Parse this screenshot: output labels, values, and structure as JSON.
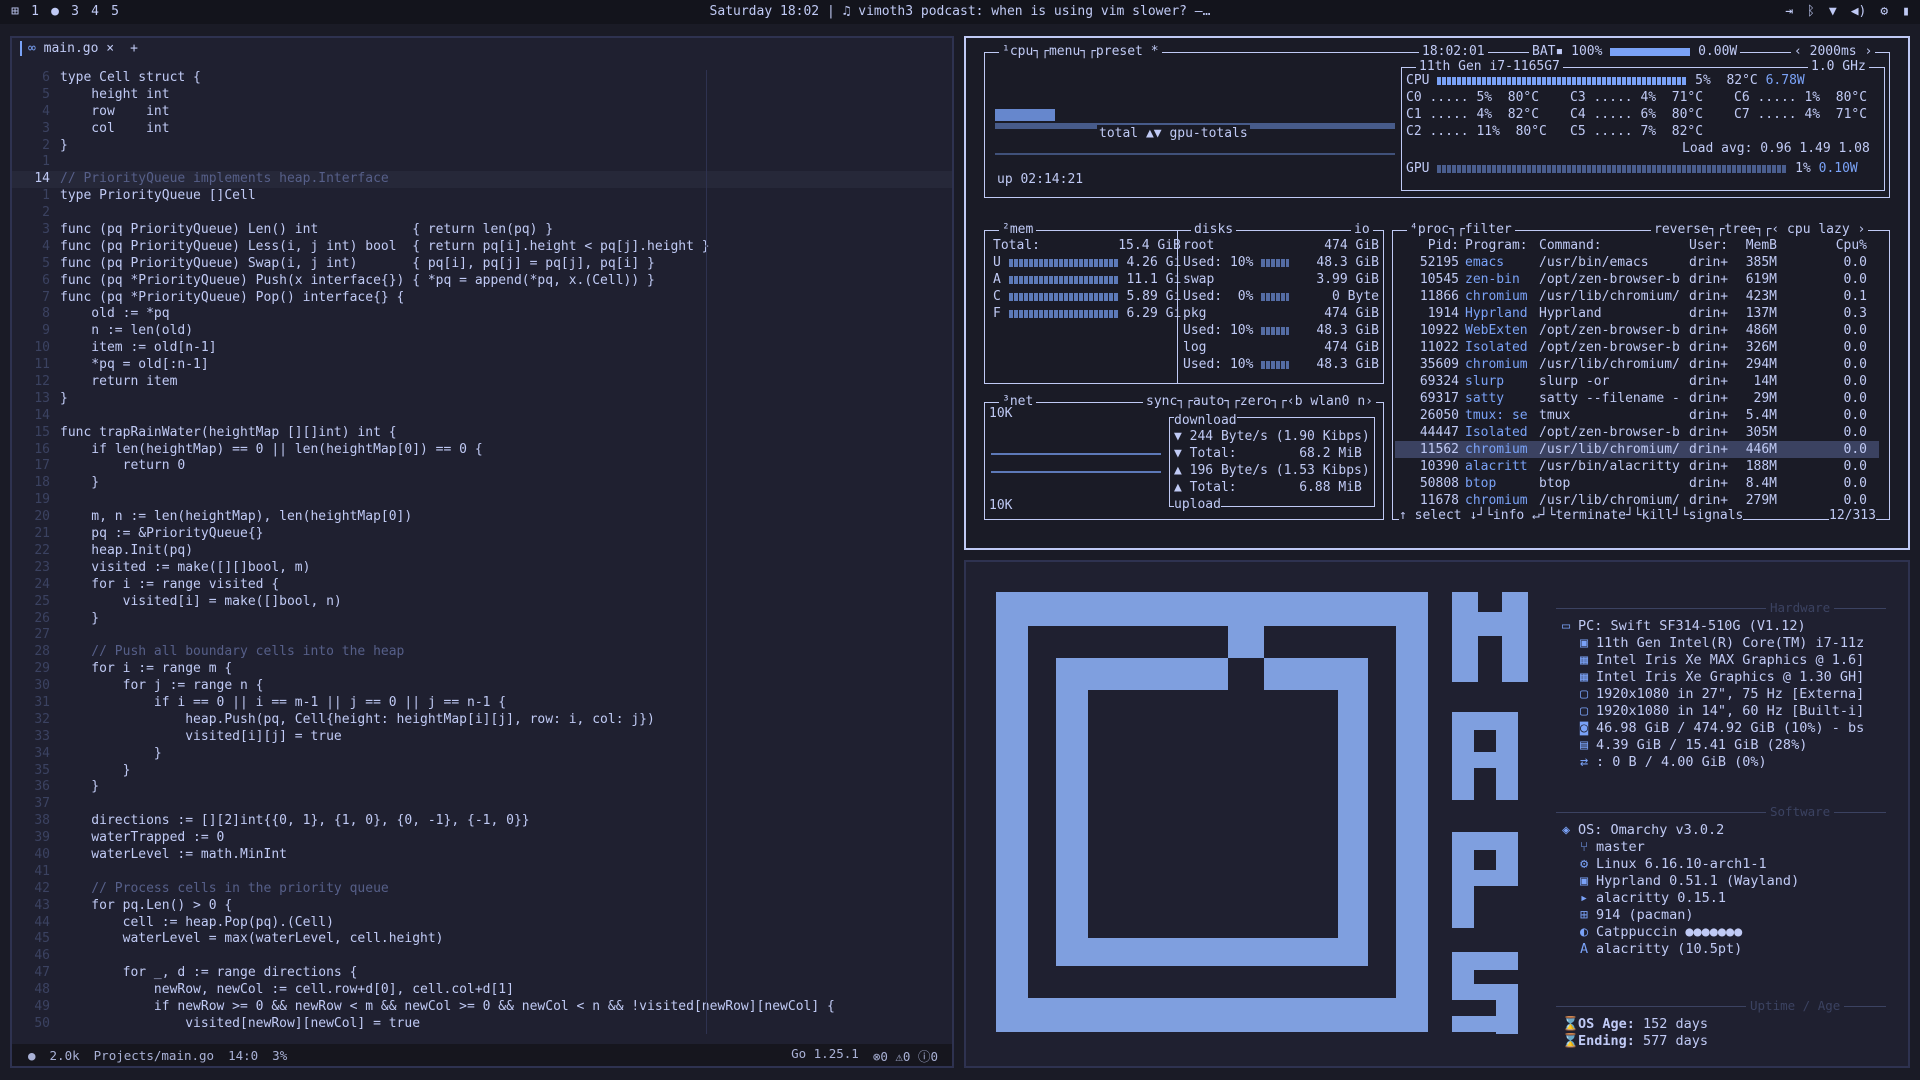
{
  "topbar": {
    "workspaces": [
      "1",
      "2",
      "3",
      "4",
      "5"
    ],
    "center_text": "Saturday 18:02 | ♫ vimoth3 podcast: when is using vim slower? –…"
  },
  "editor": {
    "tab_label": "main.go",
    "code_lines": [
      {
        "n": "6",
        "t": "type Cell struct {"
      },
      {
        "n": "5",
        "t": "    height int"
      },
      {
        "n": "4",
        "t": "    row    int"
      },
      {
        "n": "3",
        "t": "    col    int"
      },
      {
        "n": "2",
        "t": "}"
      },
      {
        "n": "1",
        "t": ""
      },
      {
        "n": "14",
        "t": "// PriorityQueue implements heap.Interface",
        "cur": true,
        "comment": true
      },
      {
        "n": "1",
        "t": "type PriorityQueue []Cell"
      },
      {
        "n": "2",
        "t": ""
      },
      {
        "n": "3",
        "t": "func (pq PriorityQueue) Len() int            { return len(pq) }"
      },
      {
        "n": "4",
        "t": "func (pq PriorityQueue) Less(i, j int) bool  { return pq[i].height < pq[j].height }"
      },
      {
        "n": "5",
        "t": "func (pq PriorityQueue) Swap(i, j int)       { pq[i], pq[j] = pq[j], pq[i] }"
      },
      {
        "n": "6",
        "t": "func (pq *PriorityQueue) Push(x interface{}) { *pq = append(*pq, x.(Cell)) }"
      },
      {
        "n": "7",
        "t": "func (pq *PriorityQueue) Pop() interface{} {"
      },
      {
        "n": "8",
        "t": "    old := *pq"
      },
      {
        "n": "9",
        "t": "    n := len(old)"
      },
      {
        "n": "10",
        "t": "    item := old[n-1]"
      },
      {
        "n": "11",
        "t": "    *pq = old[:n-1]"
      },
      {
        "n": "12",
        "t": "    return item"
      },
      {
        "n": "13",
        "t": "}"
      },
      {
        "n": "14",
        "t": ""
      },
      {
        "n": "15",
        "t": "func trapRainWater(heightMap [][]int) int {"
      },
      {
        "n": "16",
        "t": "    if len(heightMap) == 0 || len(heightMap[0]) == 0 {"
      },
      {
        "n": "17",
        "t": "        return 0"
      },
      {
        "n": "18",
        "t": "    }"
      },
      {
        "n": "19",
        "t": ""
      },
      {
        "n": "20",
        "t": "    m, n := len(heightMap), len(heightMap[0])"
      },
      {
        "n": "21",
        "t": "    pq := &PriorityQueue{}"
      },
      {
        "n": "22",
        "t": "    heap.Init(pq)"
      },
      {
        "n": "23",
        "t": "    visited := make([][]bool, m)"
      },
      {
        "n": "24",
        "t": "    for i := range visited {"
      },
      {
        "n": "25",
        "t": "        visited[i] = make([]bool, n)"
      },
      {
        "n": "26",
        "t": "    }"
      },
      {
        "n": "27",
        "t": ""
      },
      {
        "n": "28",
        "t": "    // Push all boundary cells into the heap",
        "comment": true
      },
      {
        "n": "29",
        "t": "    for i := range m {"
      },
      {
        "n": "30",
        "t": "        for j := range n {"
      },
      {
        "n": "31",
        "t": "            if i == 0 || i == m-1 || j == 0 || j == n-1 {"
      },
      {
        "n": "32",
        "t": "                heap.Push(pq, Cell{height: heightMap[i][j], row: i, col: j})"
      },
      {
        "n": "33",
        "t": "                visited[i][j] = true"
      },
      {
        "n": "34",
        "t": "            }"
      },
      {
        "n": "35",
        "t": "        }"
      },
      {
        "n": "36",
        "t": "    }"
      },
      {
        "n": "37",
        "t": ""
      },
      {
        "n": "38",
        "t": "    directions := [][2]int{{0, 1}, {1, 0}, {0, -1}, {-1, 0}}"
      },
      {
        "n": "39",
        "t": "    waterTrapped := 0"
      },
      {
        "n": "40",
        "t": "    waterLevel := math.MinInt"
      },
      {
        "n": "41",
        "t": ""
      },
      {
        "n": "42",
        "t": "    // Process cells in the priority queue",
        "comment": true
      },
      {
        "n": "43",
        "t": "    for pq.Len() > 0 {"
      },
      {
        "n": "44",
        "t": "        cell := heap.Pop(pq).(Cell)"
      },
      {
        "n": "45",
        "t": "        waterLevel = max(waterLevel, cell.height)"
      },
      {
        "n": "46",
        "t": ""
      },
      {
        "n": "47",
        "t": "        for _, d := range directions {"
      },
      {
        "n": "48",
        "t": "            newRow, newCol := cell.row+d[0], cell.col+d[1]"
      },
      {
        "n": "49",
        "t": "            if newRow >= 0 && newRow < m && newCol >= 0 && newCol < n && !visited[newRow][newCol] {"
      },
      {
        "n": "50",
        "t": "                visited[newRow][newCol] = true"
      }
    ],
    "status": {
      "size": "2.0k",
      "path": "Projects/main.go",
      "pos": "14:0",
      "pct": "3%",
      "lang": "Go 1.25.1",
      "diag": "⊗0 ⚠0 ⓘ0"
    }
  },
  "btop": {
    "cpu_title": "¹cpu┐┌menu┐┌preset *",
    "time": "18:02:01",
    "bat": "BAT▪ 100%",
    "bat_w": "0.00W",
    "interval": "2000ms",
    "model": "11th Gen i7-1165G7",
    "freq": "1.0 GHz",
    "cpu_total_pct": "5%",
    "cpu_temp": "82°C",
    "cpu_watt": "6.78W",
    "cores": [
      {
        "c": "C0",
        "p": "5%",
        "t": "80°C"
      },
      {
        "c": "C1",
        "p": "4%",
        "t": "82°C"
      },
      {
        "c": "C2",
        "p": "11%",
        "t": "80°C"
      },
      {
        "c": "C3",
        "p": "4%",
        "t": "71°C"
      },
      {
        "c": "C4",
        "p": "6%",
        "t": "80°C"
      },
      {
        "c": "C5",
        "p": "7%",
        "t": "82°C"
      },
      {
        "c": "C6",
        "p": "1%",
        "t": "80°C"
      },
      {
        "c": "C7",
        "p": "4%",
        "t": "71°C"
      }
    ],
    "load": "Load avg: 0.96 1.49 1.08",
    "gpu_pct": "1%",
    "gpu_w": "0.10W",
    "graph_label": "total ▲▼ gpu-totals",
    "uptime": "up 02:14:21",
    "mem": {
      "label": "²mem",
      "total": "15.4 GiB",
      "rows": [
        {
          "k": "U",
          "v": "4.26 Gi"
        },
        {
          "k": "A",
          "v": "11.1 Gi"
        },
        {
          "k": "C",
          "v": "5.89 Gi"
        },
        {
          "k": "F",
          "v": "6.29 Gi"
        }
      ]
    },
    "disks": {
      "label": "disks",
      "io": "io",
      "rows": [
        {
          "name": "root",
          "size": "474 GiB",
          "used": "Used: 10%",
          "usedv": "48.3 GiB"
        },
        {
          "name": "swap",
          "size": "3.99 GiB",
          "used": "Used:  0%",
          "usedv": "0 Byte"
        },
        {
          "name": "pkg",
          "size": "474 GiB",
          "used": "Used: 10%",
          "usedv": "48.3 GiB"
        },
        {
          "name": "log",
          "size": "474 GiB",
          "used": "Used: 10%",
          "usedv": "48.3 GiB"
        }
      ]
    },
    "net": {
      "label": "³net",
      "opts": "sync┐┌auto┐┌zero┐┌‹b wlan0 n›",
      "scale": "10K",
      "download": "download",
      "down_rate": "244 Byte/s (1.90 Kibps)",
      "down_total": "68.2 MiB",
      "up_rate": "196 Byte/s (1.53 Kibps)",
      "up_total": "6.88 MiB",
      "upload": "upload"
    },
    "proc": {
      "label": "⁴proc┐┌filter",
      "opts": "reverse┐┌tree┐┌‹ cpu lazy ›",
      "header": [
        "Pid:",
        "Program:",
        "Command:",
        "User:",
        "MemB",
        "Cpu%"
      ],
      "rows": [
        [
          "52195",
          "emacs",
          "/usr/bin/emacs",
          "drin+",
          "385M",
          "0.0"
        ],
        [
          "10545",
          "zen-bin",
          "/opt/zen-browser-b",
          "drin+",
          "619M",
          "0.0"
        ],
        [
          "11866",
          "chromium",
          "/usr/lib/chromium/",
          "drin+",
          "423M",
          "0.1"
        ],
        [
          "1914",
          "Hyprland",
          "Hyprland",
          "drin+",
          "137M",
          "0.3"
        ],
        [
          "10922",
          "WebExten",
          "/opt/zen-browser-b",
          "drin+",
          "486M",
          "0.0"
        ],
        [
          "11022",
          "Isolated",
          "/opt/zen-browser-b",
          "drin+",
          "326M",
          "0.0"
        ],
        [
          "35609",
          "chromium",
          "/usr/lib/chromium/",
          "drin+",
          "294M",
          "0.0"
        ],
        [
          "69324",
          "slurp",
          "slurp -or",
          "drin+",
          "14M",
          "0.0"
        ],
        [
          "69317",
          "satty",
          "satty --filename -",
          "drin+",
          "29M",
          "0.0"
        ],
        [
          "26050",
          "tmux: se",
          "tmux",
          "drin+",
          "5.4M",
          "0.0"
        ],
        [
          "44447",
          "Isolated",
          "/opt/zen-browser-b",
          "drin+",
          "305M",
          "0.0"
        ],
        [
          "11562",
          "chromium",
          "/usr/lib/chromium/",
          "drin+",
          "446M",
          "0.0"
        ],
        [
          "10390",
          "alacritt",
          "/usr/bin/alacritty",
          "drin+",
          "188M",
          "0.0"
        ],
        [
          "50808",
          "btop",
          "btop",
          "drin+",
          "8.4M",
          "0.0"
        ],
        [
          "11678",
          "chromium",
          "/usr/lib/chromium/",
          "drin+",
          "279M",
          "0.0"
        ]
      ],
      "selected_index": 11,
      "footer": "↑ select ↓┘└info ↵┘└terminate┘└kill┘└signals",
      "count": "12/313"
    }
  },
  "fastfetch": {
    "hardware_title": "Hardware",
    "hardware": [
      {
        "icon": "laptop-icon",
        "lab": "PC:",
        "v": "Swift SF314-510G (V1.12)"
      },
      {
        "icon": "cpu-icon",
        "lab": "",
        "v": "11th Gen Intel(R) Core(TM) i7-11z"
      },
      {
        "icon": "gpu-icon",
        "lab": "",
        "v": "Intel Iris Xe MAX Graphics @ 1.6]"
      },
      {
        "icon": "gpu-icon",
        "lab": "",
        "v": "Intel Iris Xe Graphics @ 1.30 GH]"
      },
      {
        "icon": "monitor-icon",
        "lab": "",
        "v": "1920x1080 in 27\", 75 Hz [Externa]"
      },
      {
        "icon": "monitor-icon",
        "lab": "",
        "v": "1920x1080 in 14\", 60 Hz [Built-i]"
      },
      {
        "icon": "disk-icon",
        "lab": "",
        "v": "46.98 GiB / 474.92 GiB (10%) - bs"
      },
      {
        "icon": "memory-icon",
        "lab": "",
        "v": "4.39 GiB / 15.41 GiB (28%)"
      },
      {
        "icon": "swap-icon",
        "lab": "",
        "v": ": 0 B / 4.00 GiB (0%)"
      }
    ],
    "software_title": "Software",
    "software": [
      {
        "icon": "os-icon",
        "lab": "OS:",
        "v": "Omarchy v3.0.2"
      },
      {
        "icon": "branch-icon",
        "lab": "",
        "v": "master"
      },
      {
        "icon": "kernel-icon",
        "lab": "",
        "v": "Linux 6.16.10-arch1-1"
      },
      {
        "icon": "window-icon",
        "lab": "",
        "v": "Hyprland 0.51.1 (Wayland)"
      },
      {
        "icon": "terminal-icon",
        "lab": "",
        "v": "alacritty 0.15.1"
      },
      {
        "icon": "package-icon",
        "lab": "",
        "v": "914 (pacman)"
      },
      {
        "icon": "palette-icon",
        "lab": "",
        "v": "Catppuccin ●●●●●●●"
      },
      {
        "icon": "font-icon",
        "lab": "",
        "v": "alacritty (10.5pt)"
      }
    ],
    "uptime_title": "Uptime / Age",
    "ages": [
      {
        "lab": "OS Age:",
        "v": "152 days"
      },
      {
        "lab": "Ending:",
        "v": "577 days"
      }
    ],
    "logo_letters": [
      "N",
      "A",
      "P",
      "S"
    ],
    "colors": {
      "logo": "#7f9fdf",
      "bg": "#1f2030"
    }
  }
}
